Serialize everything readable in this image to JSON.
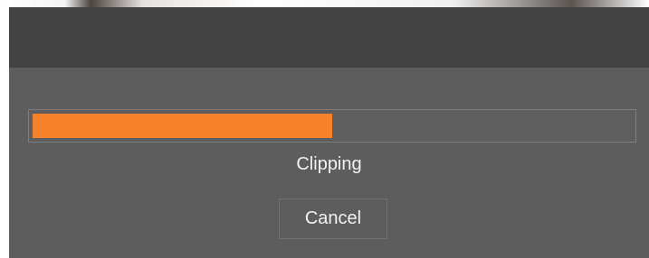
{
  "dialog": {
    "status_label": "Clipping",
    "cancel_label": "Cancel",
    "progress": 0.5
  },
  "colors": {
    "progress_fill": "#f5822a",
    "dialog_background": "#5d5d5d",
    "titlebar_background": "#424242"
  }
}
